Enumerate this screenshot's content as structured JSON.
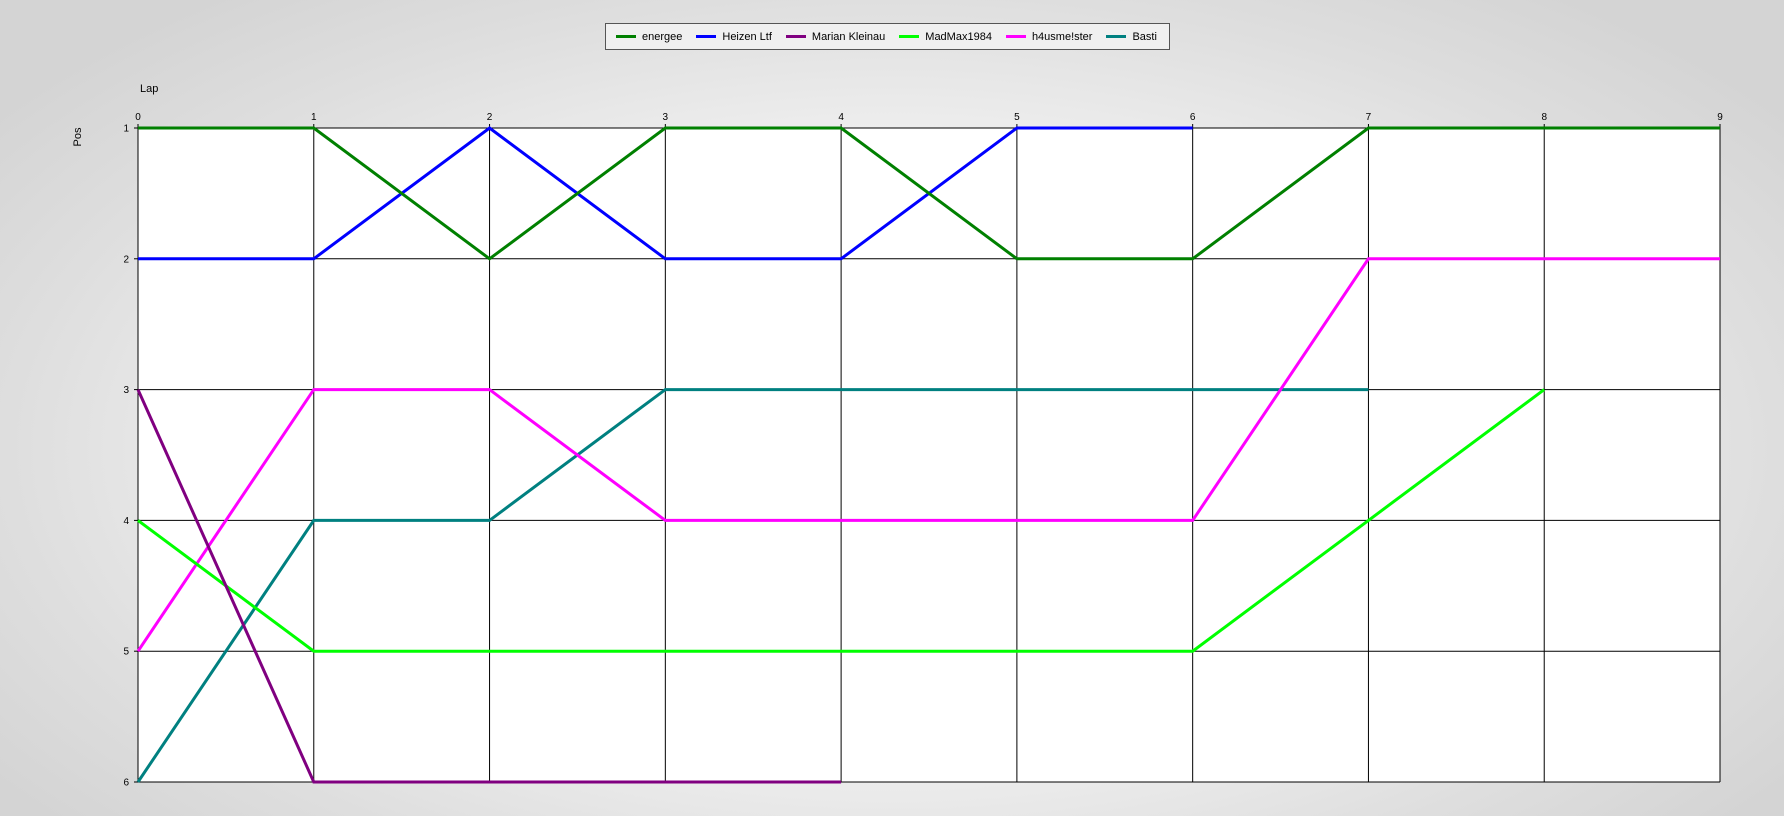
{
  "chart_data": {
    "type": "line",
    "xlabel": "Lap",
    "ylabel": "Pos",
    "x": [
      0,
      1,
      2,
      3,
      4,
      5,
      6,
      7,
      8,
      9
    ],
    "xlim": [
      0,
      9
    ],
    "ylim": [
      1,
      6
    ],
    "y_inverted": true,
    "x_ticks": [
      "0",
      "1",
      "2",
      "3",
      "4",
      "5",
      "6",
      "7",
      "8",
      "9"
    ],
    "y_ticks": [
      "1",
      "2",
      "3",
      "4",
      "5",
      "6"
    ],
    "grid": true,
    "legend_position": "top-center",
    "series": [
      {
        "name": "energee",
        "color": "#008000",
        "x": [
          0,
          1,
          2,
          3,
          4,
          5,
          6,
          7,
          8,
          9
        ],
        "values": [
          1,
          1,
          2,
          1,
          1,
          2,
          2,
          1,
          1,
          1
        ]
      },
      {
        "name": "Heizen Ltf",
        "color": "#0000ff",
        "x": [
          0,
          1,
          2,
          3,
          4,
          5,
          6
        ],
        "values": [
          2,
          2,
          1,
          2,
          2,
          1,
          1
        ]
      },
      {
        "name": "Marian Kleinau",
        "color": "#800080",
        "x": [
          0,
          1,
          2,
          3,
          4
        ],
        "values": [
          3,
          6,
          6,
          6,
          6
        ]
      },
      {
        "name": "MadMax1984",
        "color": "#00ff00",
        "x": [
          0,
          1,
          2,
          3,
          4,
          5,
          6,
          7,
          8
        ],
        "values": [
          4,
          5,
          5,
          5,
          5,
          5,
          5,
          4,
          3
        ]
      },
      {
        "name": "h4usme!ster",
        "color": "#ff00ff",
        "x": [
          0,
          1,
          2,
          3,
          4,
          5,
          6,
          7,
          8,
          9
        ],
        "values": [
          5,
          3,
          3,
          4,
          4,
          4,
          4,
          2,
          2,
          2
        ]
      },
      {
        "name": "Basti",
        "color": "#008080",
        "x": [
          0,
          1,
          2,
          3,
          4,
          5,
          6,
          7
        ],
        "values": [
          6,
          4,
          4,
          3,
          3,
          3,
          3,
          3
        ]
      }
    ]
  }
}
